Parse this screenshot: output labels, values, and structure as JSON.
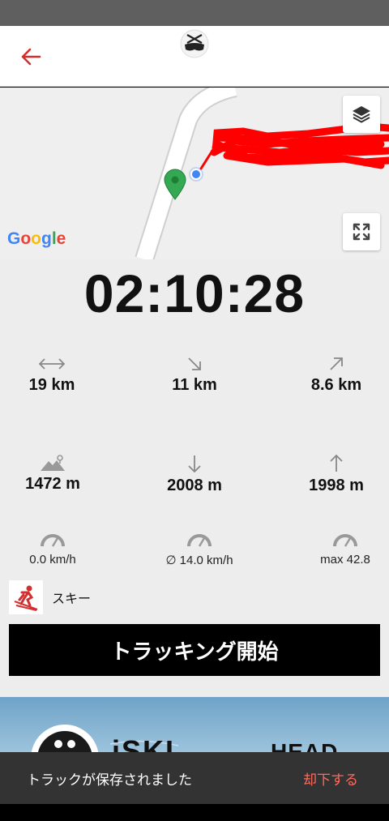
{
  "header": {
    "back_icon": "arrow-left-icon",
    "logo_icon": "ski-goggles-logo-icon",
    "accent_color": "#d32f2f"
  },
  "map": {
    "attribution": "Google",
    "layers_icon": "layers-icon",
    "fullscreen_icon": "expand-icon",
    "track_color": "#ff0000",
    "marker_color": "#34a853",
    "location_color": "#4285f4"
  },
  "stats": {
    "duration": "02:10:28",
    "distance": {
      "icon": "horizontal-arrows-icon",
      "value": "19 km"
    },
    "downhill_distance": {
      "icon": "arrow-down-right-icon",
      "value": "11 km"
    },
    "uphill_distance": {
      "icon": "arrow-up-right-icon",
      "value": "8.6 km"
    },
    "altitude": {
      "icon": "mountain-icon",
      "value": "1472 m"
    },
    "descent": {
      "icon": "arrow-down-icon",
      "value": "2008 m"
    },
    "ascent": {
      "icon": "arrow-up-icon",
      "value": "1998 m"
    },
    "speed": {
      "icon": "speedometer-icon",
      "value": "0.0 km/h"
    },
    "avg_speed": {
      "icon": "speedometer-icon",
      "value": "∅ 14.0 km/h"
    },
    "max_speed": {
      "icon": "speedometer-icon",
      "value": "max 42.8"
    }
  },
  "activity": {
    "icon": "skier-icon",
    "label": "スキー"
  },
  "start_button": {
    "label": "トラッキング開始"
  },
  "banner": {
    "brand": "iSKI",
    "partner": "HEAD"
  },
  "snackbar": {
    "message": "トラックが保存されました",
    "action": "却下する"
  }
}
